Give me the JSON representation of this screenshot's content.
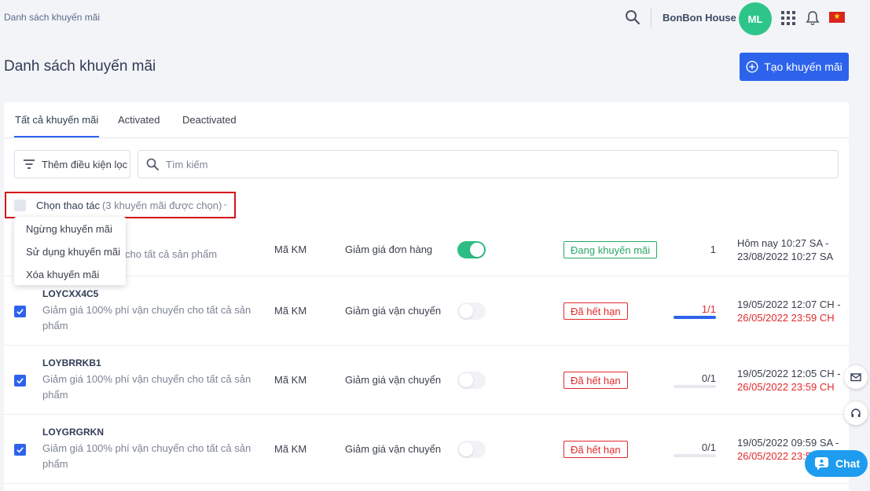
{
  "breadcrumb": "Danh sách khuyến mãi",
  "header": {
    "shop_name": "BonBon House",
    "avatar_initials": "ML",
    "flag_glyph": "★"
  },
  "page": {
    "title": "Danh sách khuyến mãi",
    "create_label": "Tạo khuyến mãi"
  },
  "tabs": [
    {
      "label": "Tất cả khuyến mãi",
      "active": true
    },
    {
      "label": "Activated",
      "active": false
    },
    {
      "label": "Deactivated",
      "active": false
    }
  ],
  "filter": {
    "add_filter_label": "Thêm điều kiện lọc",
    "search_placeholder": "Tìm kiếm"
  },
  "bulk": {
    "label": "Chọn thao tác",
    "count_text": "(3 khuyến mãi được chọn)",
    "caret": "⌄",
    "menu": [
      "Ngừng khuyến mãi",
      "Sử dụng khuyến mãi",
      "Xóa khuyến mãi"
    ]
  },
  "rows": [
    {
      "code": "",
      "desc": "cho tất cả sản phẩm",
      "type": "Mã KM",
      "kind": "Giảm giá đơn hàng",
      "active": true,
      "status": "Đang khuyến mãi",
      "usage": "1",
      "start": "Hôm nay 10:27 SA -",
      "end": "23/08/2022 10:27 SA"
    },
    {
      "code": "LOYCXX4C5",
      "desc": "Giảm giá 100% phí vận chuyển cho tất cả sản phẩm",
      "type": "Mã KM",
      "kind": "Giảm giá vận chuyển",
      "active": false,
      "status": "Đã hết hạn",
      "usage": "1/1",
      "usage_ratio": 1,
      "start": "19/05/2022 12:07 CH -",
      "end": "26/05/2022 23:59 CH"
    },
    {
      "code": "LOYBRRKB1",
      "desc": "Giảm giá 100% phí vận chuyển cho tất cả sản phẩm",
      "type": "Mã KM",
      "kind": "Giảm giá vận chuyển",
      "active": false,
      "status": "Đã hết hạn",
      "usage": "0/1",
      "usage_ratio": 0,
      "start": "19/05/2022 12:05 CH -",
      "end": "26/05/2022 23:59 CH"
    },
    {
      "code": "LOYGRGRKN",
      "desc": "Giảm giá 100% phí vận chuyển cho tất cả sản phẩm",
      "type": "Mã KM",
      "kind": "Giảm giá vận chuyển",
      "active": false,
      "status": "Đã hết hạn",
      "usage": "0/1",
      "usage_ratio": 0,
      "start": "19/05/2022 09:59 SA -",
      "end": "26/05/2022 23:59 CH"
    }
  ],
  "chat_label": "Chat",
  "colors": {
    "primary": "#2d63ec",
    "success": "#2ebd84",
    "danger": "#e02b2b",
    "highlight": "#d6121a"
  }
}
